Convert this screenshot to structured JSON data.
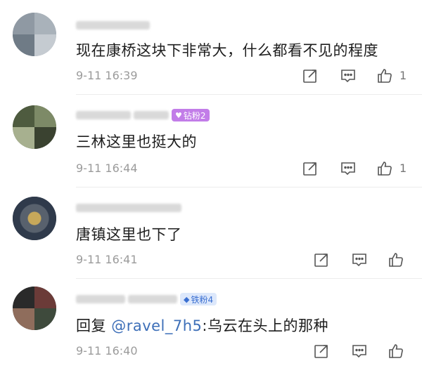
{
  "comments": [
    {
      "text": "现在康桥这块下非常大，什么都看不见的程度",
      "time": "9-11 16:39",
      "likes": "1",
      "badge": null,
      "colors": [
        "#8f99a3",
        "#a9b2ba",
        "#6f7b86",
        "#c5cbd1"
      ]
    },
    {
      "text": "三林这里也挺大的",
      "time": "9-11 16:44",
      "likes": "1",
      "badge": {
        "label": "钻粉2",
        "icon": "diamond-fan-icon"
      },
      "colors": [
        "#4e5b3f",
        "#7d8a67",
        "#a7b08f",
        "#3a4230"
      ]
    },
    {
      "text": "唐镇这里也下了",
      "time": "9-11 16:41",
      "likes": "",
      "badge": null,
      "colors": [
        "#2f3a4b",
        "#58616d",
        "#b59a52",
        "#1f2631"
      ]
    },
    {
      "text_prefix": "回复 ",
      "mention": "@ravel_7h5",
      "text_suffix": ":乌云在头上的那种",
      "time": "9-11 16:40",
      "likes": "",
      "badge": {
        "label": "铁粉4",
        "icon": "iron-fan-icon"
      },
      "colors": [
        "#2a2a2a",
        "#6b3b38",
        "#8f6d5c",
        "#3e4a3c"
      ]
    }
  ],
  "icons": {
    "reply": "reply-edit-icon",
    "comment": "comment-bubble-icon",
    "like": "thumbs-up-icon"
  },
  "palette": {
    "time": "#9b9b9b",
    "mention": "#3d6fb8",
    "diamond_badge": "#c27de8",
    "iron_badge": "#dde8fb"
  }
}
